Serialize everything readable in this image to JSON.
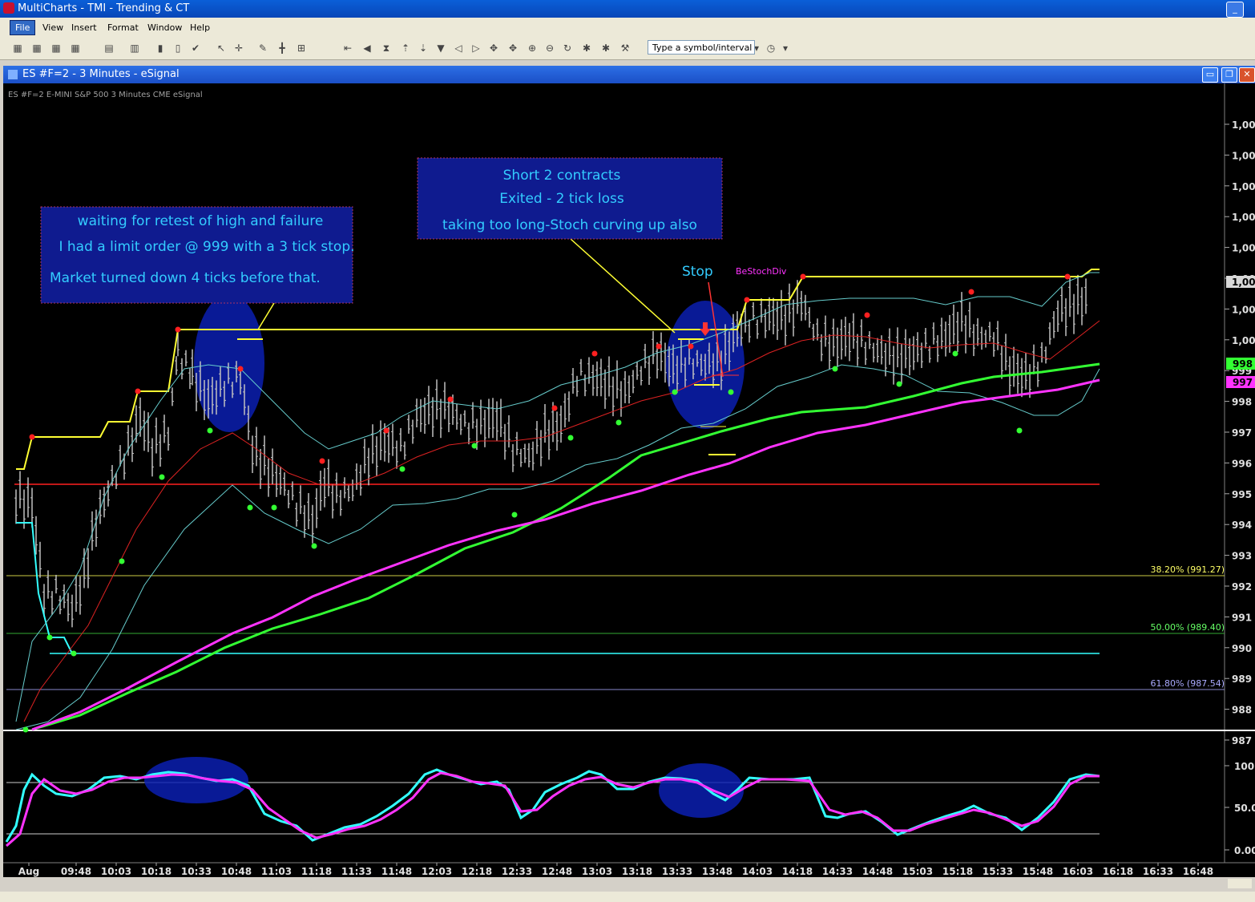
{
  "window": {
    "title": "MultiCharts - TMI - Trending & CT"
  },
  "menu": {
    "items": [
      "File",
      "View",
      "Insert",
      "Format",
      "Window",
      "Help"
    ]
  },
  "toolbar": {
    "symbol_placeholder": "Type a symbol/interval"
  },
  "chart_window": {
    "title": "ES #F=2 - 3 Minutes - eSignal",
    "info_line": "ES #F=2  E-MINI S&P 500  3 Minutes  CME  eSignal"
  },
  "price_axis": {
    "labels": [
      "1,00",
      "1,00",
      "1,00",
      "1,00",
      "1,00",
      "1,00",
      "1,00",
      "1,00",
      "999",
      "998",
      "997",
      "996",
      "995",
      "994",
      "993",
      "992",
      "991",
      "990",
      "989",
      "988",
      "987"
    ],
    "tag_green": "998",
    "tag_magenta": "997"
  },
  "fib_levels": [
    {
      "label": "38.20% (991.27)",
      "color": "#ffff66"
    },
    {
      "label": "50.00% (989.40)",
      "color": "#66ff66"
    },
    {
      "label": "61.80% (987.54)",
      "color": "#aaaaff"
    }
  ],
  "time_axis": {
    "labels": [
      "Aug",
      "09:48",
      "10:03",
      "10:18",
      "10:33",
      "10:48",
      "11:03",
      "11:18",
      "11:33",
      "11:48",
      "12:03",
      "12:18",
      "12:33",
      "12:48",
      "13:03",
      "13:18",
      "13:33",
      "13:48",
      "14:03",
      "14:18",
      "14:33",
      "14:48",
      "15:03",
      "15:18",
      "15:33",
      "15:48",
      "16:03",
      "16:18",
      "16:33",
      "16:48"
    ]
  },
  "stoch_axis": {
    "labels": [
      "100",
      "50.0",
      "0.00"
    ]
  },
  "annotations": {
    "box1": [
      "waiting for retest of high and failure",
      "I had a limit order @ 999 with a 3 tick stop.",
      "Market turned down 4 ticks before that."
    ],
    "box2": [
      "Short 2 contracts",
      "Exited - 2 tick loss",
      "taking too long-Stoch curving up also"
    ],
    "stop_label": "Stop",
    "signal_label": "BeStochDiv"
  },
  "colors": {
    "annotation_bg": "#0f1b8f",
    "annotation_text": "#33ccff",
    "sma_fast": "#33ff33",
    "sma_slow": "#ff33ff",
    "channel": "#ffff33"
  }
}
